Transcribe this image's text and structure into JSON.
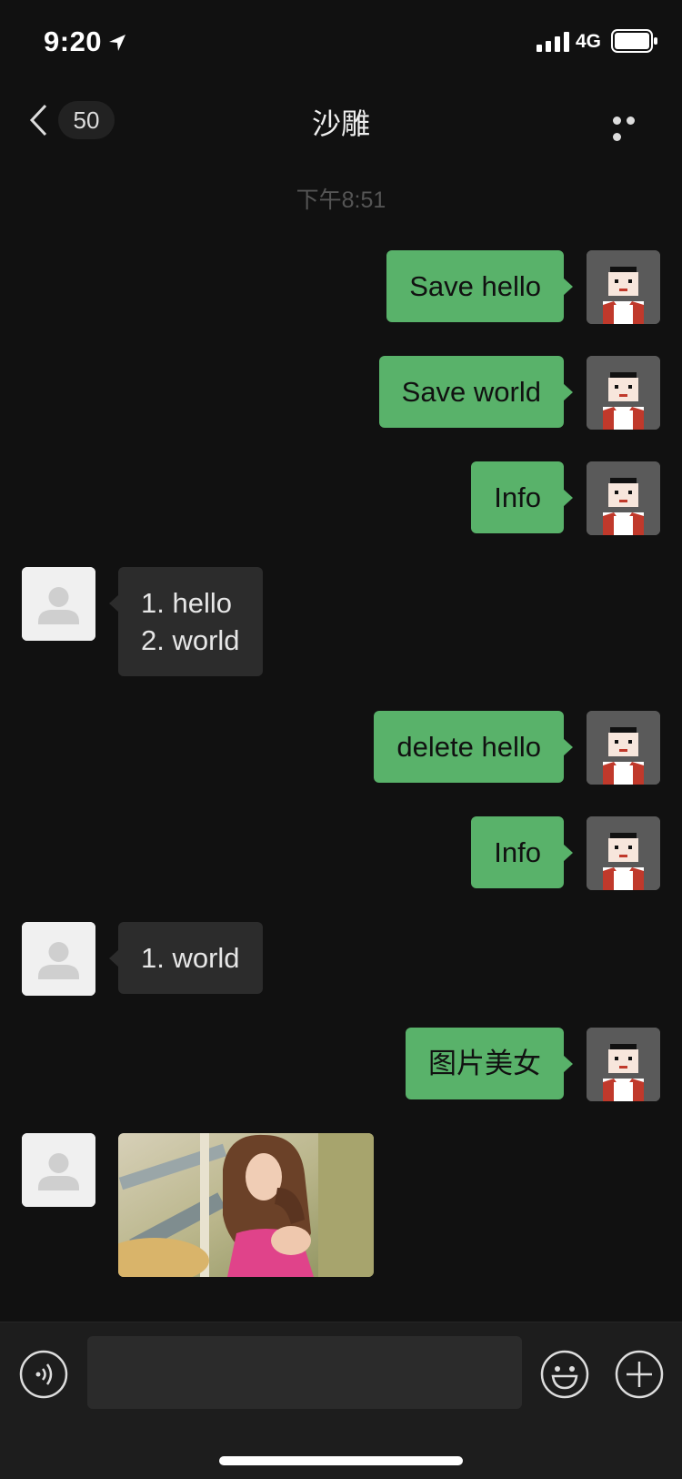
{
  "status_bar": {
    "time": "9:20",
    "network": "4G"
  },
  "nav": {
    "unread_count": "50",
    "title": "沙雕"
  },
  "chat": {
    "timestamp": "下午8:51",
    "messages": [
      {
        "sender": "self",
        "lines": [
          "Save hello"
        ]
      },
      {
        "sender": "self",
        "lines": [
          "Save world"
        ]
      },
      {
        "sender": "self",
        "lines": [
          "Info"
        ]
      },
      {
        "sender": "other",
        "lines": [
          "1. hello",
          "2. world"
        ]
      },
      {
        "sender": "self",
        "lines": [
          "delete hello"
        ]
      },
      {
        "sender": "self",
        "lines": [
          "Info"
        ]
      },
      {
        "sender": "other",
        "lines": [
          "1. world"
        ]
      },
      {
        "sender": "self",
        "lines": [
          "图片美女"
        ]
      },
      {
        "sender": "other",
        "type": "image",
        "content": "photo"
      }
    ]
  },
  "input_bar": {
    "text_value": ""
  },
  "icons": {
    "back": "chevron-left-icon",
    "more": "more-icon",
    "voice": "voice-icon",
    "emoji": "emoji-icon",
    "plus": "plus-icon",
    "self_avatar": "pixel-avatar",
    "other_avatar": "default-avatar"
  },
  "colors": {
    "background": "#111111",
    "self_bubble": "#59b26a",
    "other_bubble": "#2c2c2c"
  }
}
